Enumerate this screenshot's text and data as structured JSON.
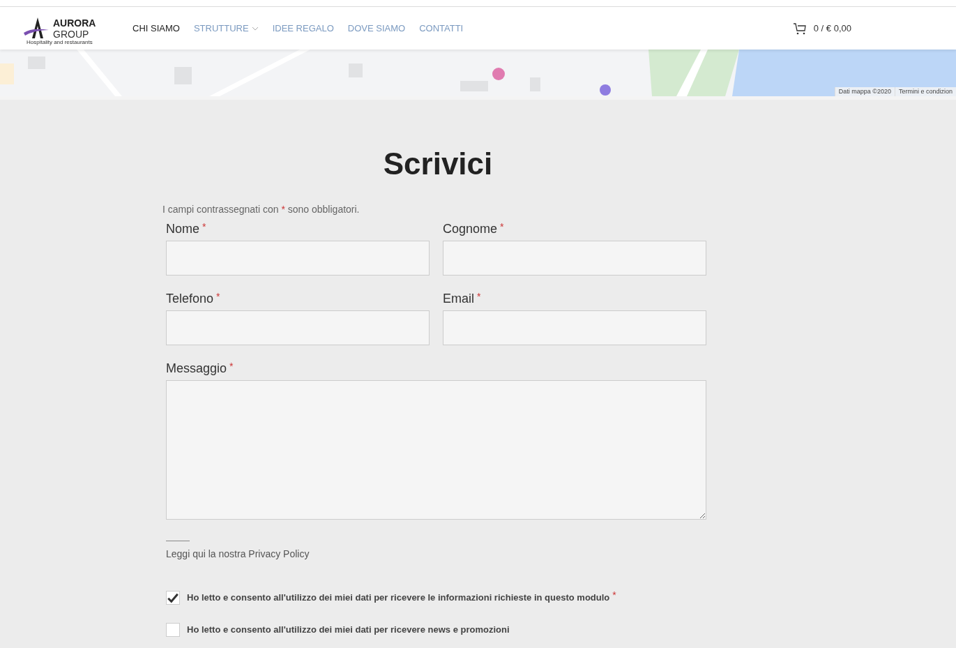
{
  "header": {
    "logo": {
      "name": "AURORA",
      "sub": "GROUP",
      "tagline": "Hospitality and restaurants"
    },
    "nav": [
      {
        "label": "CHI SIAMO",
        "selected": true,
        "has_submenu": false
      },
      {
        "label": "STRUTTURE",
        "selected": false,
        "has_submenu": true
      },
      {
        "label": "IDEE REGALO",
        "selected": false,
        "has_submenu": false
      },
      {
        "label": "DOVE SIAMO",
        "selected": false,
        "has_submenu": false
      },
      {
        "label": "CONTATTI",
        "selected": false,
        "has_submenu": false
      }
    ],
    "cart": "0 / € 0,00"
  },
  "map": {
    "kind": "picture",
    "attribution": [
      "Dati mappa ©2020",
      "Termini e condizion"
    ]
  },
  "form": {
    "title": "Scrivici",
    "note_before": "I campi contrassegnati con",
    "note_mark": "*",
    "note_after": "sono obbligatori.",
    "fields": [
      {
        "label": "Nome",
        "required": true,
        "kind": "input"
      },
      {
        "label": "Cognome",
        "required": true,
        "kind": "input"
      },
      {
        "label": "Telefono",
        "required": true,
        "kind": "input"
      },
      {
        "label": "Email",
        "required": true,
        "kind": "input"
      },
      {
        "label": "Messaggio",
        "required": true,
        "kind": "textarea"
      }
    ],
    "privacy_link": "Leggi qui la nostra Privacy Policy",
    "consents": [
      {
        "label": "Ho letto e consento all'utilizzo dei miei dati per ricevere le informazioni richieste in questo modulo",
        "checked": true,
        "required": true
      },
      {
        "label": "Ho letto e consento all'utilizzo dei miei dati per ricevere news e promozioni",
        "checked": false,
        "required": false
      }
    ]
  }
}
